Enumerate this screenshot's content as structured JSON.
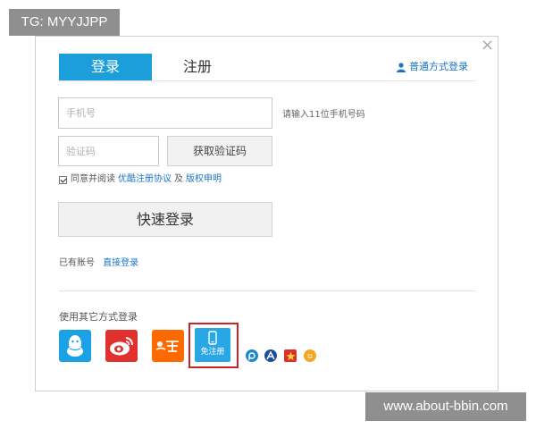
{
  "watermarks": {
    "top": "TG: MYYJJPP",
    "bottom": "www.about-bbin.com"
  },
  "dialog": {
    "close_icon": "close-icon",
    "tabs": {
      "login": "登录",
      "register": "注册"
    },
    "normal_login_link": "普通方式登录",
    "phone": {
      "placeholder": "手机号",
      "hint": "请输入11位手机号码"
    },
    "code": {
      "placeholder": "验证码",
      "get_code_button": "获取验证码"
    },
    "agreement": {
      "checked": true,
      "prefix": "同意并阅读",
      "terms_link": "优酷注册协议",
      "conjunction": "及",
      "copyright_link": "版权申明"
    },
    "quick_login_button": "快速登录",
    "have_account": {
      "text": "已有账号",
      "link": "直接登录"
    },
    "other_ways": {
      "label": "使用其它方式登录",
      "providers": [
        {
          "name": "qq",
          "icon": "qq-penguin-icon",
          "color": "#1aa1e6"
        },
        {
          "name": "weibo",
          "icon": "weibo-eye-icon",
          "color": "#e0312e"
        },
        {
          "name": "taobao",
          "icon": "taobao-icon",
          "color": "#ff6a00"
        }
      ],
      "free_register": {
        "label": "免注册",
        "icon": "phone-icon",
        "highlight_color": "#c8242b"
      },
      "mini_icons": [
        "p-logo-icon",
        "a-logo-icon",
        "star-icon",
        "smile-icon"
      ]
    }
  },
  "colors": {
    "accent": "#1b9ed9",
    "link": "#1b74c5"
  }
}
